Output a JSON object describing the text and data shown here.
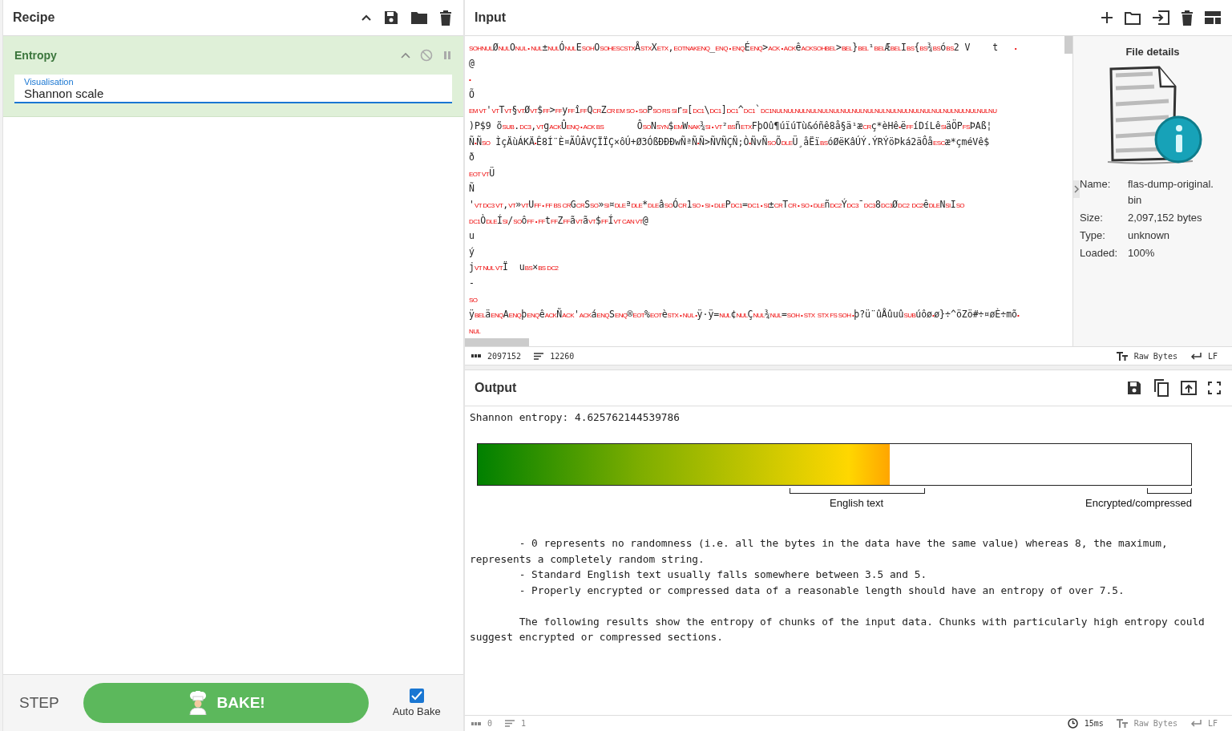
{
  "recipe": {
    "title": "Recipe"
  },
  "operation": {
    "name": "Entropy",
    "disabled": false,
    "paused": false,
    "field": {
      "label": "Visualisation",
      "value": "Shannon scale"
    }
  },
  "controls": {
    "step": "STEP",
    "bake": "BAKE!",
    "auto_bake": {
      "label": "Auto Bake",
      "checked": true
    }
  },
  "input": {
    "title": "Input",
    "lines": [
      [
        {
          "kind": "ctl",
          "text": "SOHNUL"
        },
        {
          "kind": "txt",
          "text": "Ø"
        },
        {
          "kind": "ctl",
          "text": "NUL"
        },
        {
          "kind": "txt",
          "text": "O"
        },
        {
          "kind": "ctl",
          "text": "NUL • NUL"
        },
        {
          "kind": "txt",
          "text": "±"
        },
        {
          "kind": "ctl",
          "text": "NUL"
        },
        {
          "kind": "txt",
          "text": "Ó"
        },
        {
          "kind": "ctl",
          "text": "NUL"
        },
        {
          "kind": "txt",
          "text": "E"
        },
        {
          "kind": "ctl",
          "text": "SOH"
        },
        {
          "kind": "txt",
          "text": "O"
        },
        {
          "kind": "ctl",
          "text": "SOHESCSTX"
        },
        {
          "kind": "txt",
          "text": "Å"
        },
        {
          "kind": "ctl",
          "text": "STX"
        },
        {
          "kind": "txt",
          "text": "X"
        },
        {
          "kind": "ctl",
          "text": "ETX"
        },
        {
          "kind": "txt",
          "text": ","
        },
        {
          "kind": "ctl",
          "text": "EOTNAKENQ"
        },
        {
          "kind": "txt",
          "text": "_"
        },
        {
          "kind": "ctl",
          "text": "ENQ • ENQ"
        },
        {
          "kind": "txt",
          "text": "É"
        },
        {
          "kind": "ctl",
          "text": "ENQ"
        },
        {
          "kind": "txt",
          "text": ">"
        },
        {
          "kind": "ctl",
          "text": "ACK • ACK"
        },
        {
          "kind": "txt",
          "text": "ê"
        },
        {
          "kind": "ctl",
          "text": "ACKSOHBEL"
        },
        {
          "kind": "txt",
          "text": ">"
        },
        {
          "kind": "ctl",
          "text": "BEL"
        },
        {
          "kind": "txt",
          "text": "}"
        },
        {
          "kind": "ctl",
          "text": "BEL"
        },
        {
          "kind": "txt",
          "text": "¹"
        },
        {
          "kind": "ctl",
          "text": "BEL"
        },
        {
          "kind": "txt",
          "text": "Æ"
        },
        {
          "kind": "ctl",
          "text": "BEL"
        },
        {
          "kind": "txt",
          "text": "I"
        },
        {
          "kind": "ctl",
          "text": "BS"
        },
        {
          "kind": "txt",
          "text": "{"
        },
        {
          "kind": "ctl",
          "text": "BS"
        },
        {
          "kind": "txt",
          "text": "¾"
        },
        {
          "kind": "ctl",
          "text": "BS"
        },
        {
          "kind": "txt",
          "text": "ó"
        },
        {
          "kind": "ctl",
          "text": "BS"
        },
        {
          "kind": "txt",
          "text": "2 V    t   "
        },
        {
          "kind": "ctl",
          "text": "•"
        }
      ],
      [
        {
          "kind": "txt",
          "text": "@"
        }
      ],
      [
        {
          "kind": "ctl",
          "text": "•"
        }
      ],
      [
        {
          "kind": "txt",
          "text": "Õ"
        }
      ],
      [
        {
          "kind": "ctl",
          "text": "EM VT"
        },
        {
          "kind": "txt",
          "text": "'"
        },
        {
          "kind": "ctl",
          "text": "VT"
        },
        {
          "kind": "txt",
          "text": "T"
        },
        {
          "kind": "ctl",
          "text": "VT"
        },
        {
          "kind": "txt",
          "text": "§"
        },
        {
          "kind": "ctl",
          "text": "VT"
        },
        {
          "kind": "txt",
          "text": "Ø"
        },
        {
          "kind": "ctl",
          "text": "VT"
        },
        {
          "kind": "txt",
          "text": "$"
        },
        {
          "kind": "ctl",
          "text": "FF"
        },
        {
          "kind": "txt",
          "text": ">"
        },
        {
          "kind": "ctl",
          "text": "FF"
        },
        {
          "kind": "txt",
          "text": "y"
        },
        {
          "kind": "ctl",
          "text": "FF"
        },
        {
          "kind": "txt",
          "text": "î"
        },
        {
          "kind": "ctl",
          "text": "FF"
        },
        {
          "kind": "txt",
          "text": "Q"
        },
        {
          "kind": "ctl",
          "text": "CR"
        },
        {
          "kind": "txt",
          "text": "Z"
        },
        {
          "kind": "ctl",
          "text": "CR EM SO • SO"
        },
        {
          "kind": "txt",
          "text": "P"
        },
        {
          "kind": "ctl",
          "text": "SO RS SI"
        },
        {
          "kind": "txt",
          "text": "r"
        },
        {
          "kind": "ctl",
          "text": "SI"
        },
        {
          "kind": "txt",
          "text": "["
        },
        {
          "kind": "ctl",
          "text": "DC1"
        },
        {
          "kind": "txt",
          "text": "\\"
        },
        {
          "kind": "ctl",
          "text": "DC1"
        },
        {
          "kind": "txt",
          "text": "]"
        },
        {
          "kind": "ctl",
          "text": "DC1"
        },
        {
          "kind": "txt",
          "text": "^"
        },
        {
          "kind": "ctl",
          "text": "DC1"
        },
        {
          "kind": "txt",
          "text": "`"
        },
        {
          "kind": "ctl",
          "text": "DC1NULNULNULNULNULNULNULNULNULNULNULNULNULNULNULNULNULNULNULNU"
        }
      ],
      [
        {
          "kind": "txt",
          "text": ")P$9 õ"
        },
        {
          "kind": "ctl",
          "text": "SUB"
        },
        {
          "kind": "txt",
          "text": "."
        },
        {
          "kind": "ctl",
          "text": "DC3"
        },
        {
          "kind": "txt",
          "text": ","
        },
        {
          "kind": "ctl",
          "text": "VT"
        },
        {
          "kind": "txt",
          "text": "g"
        },
        {
          "kind": "ctl",
          "text": "ACK"
        },
        {
          "kind": "txt",
          "text": "Û"
        },
        {
          "kind": "ctl",
          "text": "ENQ • ACK BS"
        },
        {
          "kind": "txt",
          "text": "      Ô"
        },
        {
          "kind": "ctl",
          "text": "SO"
        },
        {
          "kind": "txt",
          "text": "N"
        },
        {
          "kind": "ctl",
          "text": "SYN"
        },
        {
          "kind": "txt",
          "text": "$"
        },
        {
          "kind": "ctl",
          "text": "EM"
        },
        {
          "kind": "txt",
          "text": "W"
        },
        {
          "kind": "ctl",
          "text": "NAK"
        },
        {
          "kind": "txt",
          "text": "¾"
        },
        {
          "kind": "ctl",
          "text": "SI • VT"
        },
        {
          "kind": "txt",
          "text": "²"
        },
        {
          "kind": "ctl",
          "text": "BS"
        },
        {
          "kind": "txt",
          "text": "ñ"
        },
        {
          "kind": "ctl",
          "text": "ETX"
        },
        {
          "kind": "txt",
          "text": "FþOû¶úïúTù&óñê8å§ä¹æ"
        },
        {
          "kind": "ctl",
          "text": "CR"
        },
        {
          "kind": "txt",
          "text": "ç*èHê"
        },
        {
          "kind": "ctl",
          "text": "•"
        },
        {
          "kind": "txt",
          "text": "ë"
        },
        {
          "kind": "ctl",
          "text": "FF"
        },
        {
          "kind": "txt",
          "text": "íDíLê"
        },
        {
          "kind": "ctl",
          "text": "SI"
        },
        {
          "kind": "txt",
          "text": "äÖP"
        },
        {
          "kind": "ctl",
          "text": "FS"
        },
        {
          "kind": "txt",
          "text": "ÞAß¦"
        }
      ],
      [
        {
          "kind": "txt",
          "text": "Ñ"
        },
        {
          "kind": "ctl",
          "text": "•"
        },
        {
          "kind": "txt",
          "text": "Ñ"
        },
        {
          "kind": "ctl",
          "text": "SO"
        },
        {
          "kind": "txt",
          "text": " ÌçÄùÁKÄ"
        },
        {
          "kind": "ctl",
          "text": "•"
        },
        {
          "kind": "txt",
          "text": "Ê8Í¨È¤ÃÛÂVÇÏÏÇ×ôÚ+Ø3ÓßÐÐÐwÑªÑ"
        },
        {
          "kind": "ctl",
          "text": "•"
        },
        {
          "kind": "txt",
          "text": "Ñ>ÑVÑÇÑ;Ò"
        },
        {
          "kind": "ctl",
          "text": "•"
        },
        {
          "kind": "txt",
          "text": "ÑvÑ"
        },
        {
          "kind": "ctl",
          "text": "SO"
        },
        {
          "kind": "txt",
          "text": "Õ"
        },
        {
          "kind": "ctl",
          "text": "DLE"
        },
        {
          "kind": "txt",
          "text": "Ü¸åËï"
        },
        {
          "kind": "ctl",
          "text": "BS"
        },
        {
          "kind": "txt",
          "text": "óØëKâÚÝ.ÝRÝöÞká2äÔå"
        },
        {
          "kind": "ctl",
          "text": "ESC"
        },
        {
          "kind": "txt",
          "text": "æ*çméVê$"
        }
      ],
      [
        {
          "kind": "txt",
          "text": "ð"
        }
      ],
      [
        {
          "kind": "ctl",
          "text": "EOT VT"
        },
        {
          "kind": "txt",
          "text": "Ü"
        }
      ],
      [
        {
          "kind": "txt",
          "text": "Ñ"
        }
      ],
      [
        {
          "kind": "txt",
          "text": "'"
        },
        {
          "kind": "ctl",
          "text": "VT DC3 VT"
        },
        {
          "kind": "txt",
          "text": ","
        },
        {
          "kind": "ctl",
          "text": "VT"
        },
        {
          "kind": "txt",
          "text": "»"
        },
        {
          "kind": "ctl",
          "text": "VT"
        },
        {
          "kind": "txt",
          "text": "U"
        },
        {
          "kind": "ctl",
          "text": "FF • FF BS CR"
        },
        {
          "kind": "txt",
          "text": "G"
        },
        {
          "kind": "ctl",
          "text": "CR"
        },
        {
          "kind": "txt",
          "text": "S"
        },
        {
          "kind": "ctl",
          "text": "SO"
        },
        {
          "kind": "txt",
          "text": "»"
        },
        {
          "kind": "ctl",
          "text": "SI"
        },
        {
          "kind": "txt",
          "text": "¤"
        },
        {
          "kind": "ctl",
          "text": "DLE"
        },
        {
          "kind": "txt",
          "text": "ª"
        },
        {
          "kind": "ctl",
          "text": "DLE"
        },
        {
          "kind": "txt",
          "text": "*"
        },
        {
          "kind": "ctl",
          "text": "DLE"
        },
        {
          "kind": "txt",
          "text": "â"
        },
        {
          "kind": "ctl",
          "text": "SO"
        },
        {
          "kind": "txt",
          "text": "Ó"
        },
        {
          "kind": "ctl",
          "text": "CR"
        },
        {
          "kind": "txt",
          "text": "1"
        },
        {
          "kind": "ctl",
          "text": "SO • SI • DLE"
        },
        {
          "kind": "txt",
          "text": "P"
        },
        {
          "kind": "ctl",
          "text": "DC1"
        },
        {
          "kind": "txt",
          "text": "="
        },
        {
          "kind": "ctl",
          "text": "DC1 • SI"
        },
        {
          "kind": "txt",
          "text": "±"
        },
        {
          "kind": "ctl",
          "text": "CR"
        },
        {
          "kind": "txt",
          "text": "T"
        },
        {
          "kind": "ctl",
          "text": "CR • SO • DLE"
        },
        {
          "kind": "txt",
          "text": "ñ"
        },
        {
          "kind": "ctl",
          "text": "DC2"
        },
        {
          "kind": "txt",
          "text": "Ý"
        },
        {
          "kind": "ctl",
          "text": "DC3"
        },
        {
          "kind": "txt",
          "text": "¯"
        },
        {
          "kind": "ctl",
          "text": "DC3"
        },
        {
          "kind": "txt",
          "text": "8"
        },
        {
          "kind": "ctl",
          "text": "DC3"
        },
        {
          "kind": "txt",
          "text": "Ø"
        },
        {
          "kind": "ctl",
          "text": "DC2  DC2"
        },
        {
          "kind": "txt",
          "text": "ê"
        },
        {
          "kind": "ctl",
          "text": "DLE"
        },
        {
          "kind": "txt",
          "text": "N"
        },
        {
          "kind": "ctl",
          "text": "SI"
        },
        {
          "kind": "txt",
          "text": "I"
        },
        {
          "kind": "ctl",
          "text": "SO"
        }
      ],
      [
        {
          "kind": "ctl",
          "text": "DC1"
        },
        {
          "kind": "txt",
          "text": "Ò"
        },
        {
          "kind": "ctl",
          "text": "DLE"
        },
        {
          "kind": "txt",
          "text": "Í"
        },
        {
          "kind": "ctl",
          "text": "SI"
        },
        {
          "kind": "txt",
          "text": "/"
        },
        {
          "kind": "ctl",
          "text": "SO"
        },
        {
          "kind": "txt",
          "text": "ô"
        },
        {
          "kind": "ctl",
          "text": "FF • FF"
        },
        {
          "kind": "txt",
          "text": "t"
        },
        {
          "kind": "ctl",
          "text": "FF"
        },
        {
          "kind": "txt",
          "text": "Z"
        },
        {
          "kind": "ctl",
          "text": "FF"
        },
        {
          "kind": "txt",
          "text": "ã"
        },
        {
          "kind": "ctl",
          "text": "VT"
        },
        {
          "kind": "txt",
          "text": "ã"
        },
        {
          "kind": "ctl",
          "text": "VT"
        },
        {
          "kind": "txt",
          "text": "$"
        },
        {
          "kind": "ctl",
          "text": "FF"
        },
        {
          "kind": "txt",
          "text": "Í"
        },
        {
          "kind": "ctl",
          "text": "VT CAN VT"
        },
        {
          "kind": "txt",
          "text": "@"
        }
      ],
      [
        {
          "kind": "txt",
          "text": "u"
        }
      ],
      [
        {
          "kind": "txt",
          "text": "ý"
        }
      ],
      [
        {
          "kind": "txt",
          "text": "j"
        },
        {
          "kind": "ctl",
          "text": "VT NUL VT"
        },
        {
          "kind": "txt",
          "text": "Ï  u"
        },
        {
          "kind": "ctl",
          "text": "BS"
        },
        {
          "kind": "txt",
          "text": "×"
        },
        {
          "kind": "ctl",
          "text": "BS DC2"
        }
      ],
      [
        {
          "kind": "txt",
          "text": "-"
        }
      ],
      [
        {
          "kind": "ctl",
          "text": "SO"
        }
      ],
      [
        {
          "kind": "txt",
          "text": "ÿ"
        },
        {
          "kind": "ctl",
          "text": "BEL"
        },
        {
          "kind": "txt",
          "text": "ä"
        },
        {
          "kind": "ctl",
          "text": "ENQ"
        },
        {
          "kind": "txt",
          "text": "A"
        },
        {
          "kind": "ctl",
          "text": "ENQ"
        },
        {
          "kind": "txt",
          "text": "þ"
        },
        {
          "kind": "ctl",
          "text": "ENQ"
        },
        {
          "kind": "txt",
          "text": "ê"
        },
        {
          "kind": "ctl",
          "text": "ACK"
        },
        {
          "kind": "txt",
          "text": "Ñ"
        },
        {
          "kind": "ctl",
          "text": "ACK"
        },
        {
          "kind": "txt",
          "text": "'"
        },
        {
          "kind": "ctl",
          "text": "ACK"
        },
        {
          "kind": "txt",
          "text": "á"
        },
        {
          "kind": "ctl",
          "text": "ENQ"
        },
        {
          "kind": "txt",
          "text": "S"
        },
        {
          "kind": "ctl",
          "text": "ENQ"
        },
        {
          "kind": "txt",
          "text": "®"
        },
        {
          "kind": "ctl",
          "text": "EOT"
        },
        {
          "kind": "txt",
          "text": "%"
        },
        {
          "kind": "ctl",
          "text": "EOT"
        },
        {
          "kind": "txt",
          "text": "è"
        },
        {
          "kind": "ctl",
          "text": "STX • NUL •"
        },
        {
          "kind": "txt",
          "text": "ÿ·ÿ="
        },
        {
          "kind": "ctl",
          "text": "NUL"
        },
        {
          "kind": "txt",
          "text": "¢"
        },
        {
          "kind": "ctl",
          "text": "NUL"
        },
        {
          "kind": "txt",
          "text": "Ç"
        },
        {
          "kind": "ctl",
          "text": "NUL"
        },
        {
          "kind": "txt",
          "text": "¾"
        },
        {
          "kind": "ctl",
          "text": "NUL"
        },
        {
          "kind": "txt",
          "text": "="
        },
        {
          "kind": "ctl",
          "text": "SOH • STX  STX FS SOH •"
        },
        {
          "kind": "txt",
          "text": "þ?ü¨ûÅûuû"
        },
        {
          "kind": "ctl",
          "text": "SUB"
        },
        {
          "kind": "txt",
          "text": "úôø"
        },
        {
          "kind": "ctl",
          "text": "•"
        },
        {
          "kind": "txt",
          "text": "ø}÷^öZö#÷¤øÈ÷mõ"
        },
        {
          "kind": "ctl",
          "text": "•"
        }
      ],
      [
        {
          "kind": "ctl",
          "text": "NUL"
        }
      ]
    ],
    "status": {
      "length": "2097152",
      "lines": "12260",
      "format": "Raw Bytes",
      "eol": "LF"
    }
  },
  "file_details": {
    "title": "File details",
    "rows": [
      {
        "label": "Name:",
        "value": "flas-dump-original.bin"
      },
      {
        "label": "Size:",
        "value": "2,097,152 bytes"
      },
      {
        "label": "Type:",
        "value": "unknown"
      },
      {
        "label": "Loaded:",
        "value": "100%"
      }
    ]
  },
  "output": {
    "title": "Output",
    "entropy": "Shannon entropy: 4.625762144539786",
    "gauge": {
      "level": 0.578,
      "english_label": "English text",
      "encrypted_label": "Encrypted/compressed"
    },
    "paragraphs": [
      "        - 0 represents no randomness (i.e. all the bytes in the data have the same value) whereas 8, the maximum, represents a completely random string.",
      "        - Standard English text usually falls somewhere between 3.5 and 5.",
      "        - Properly encrypted or compressed data of a reasonable length should have an entropy of over 7.5.",
      "        The following results show the entropy of chunks of the input data. Chunks with particularly high entropy could suggest encrypted or compressed sections."
    ],
    "status": {
      "length": "0",
      "lines": "1",
      "time": "15ms",
      "format": "Raw Bytes",
      "eol": "LF"
    }
  }
}
